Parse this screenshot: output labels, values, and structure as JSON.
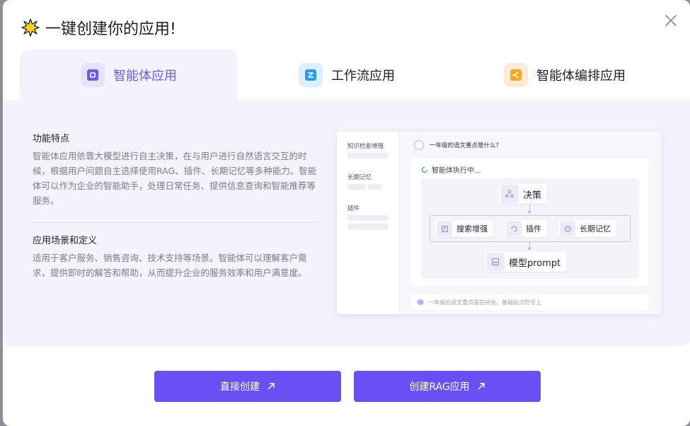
{
  "dialog": {
    "title": "一键创建你的应用!"
  },
  "tabs": [
    {
      "label": "智能体应用",
      "active": true,
      "icon": "agent-icon",
      "color": "#6c5ce7"
    },
    {
      "label": "工作流应用",
      "active": false,
      "icon": "workflow-icon",
      "color": "#2d8cf0"
    },
    {
      "label": "智能体编排应用",
      "active": false,
      "icon": "orchestration-icon",
      "color": "#f5a623"
    }
  ],
  "features": {
    "heading": "功能特点",
    "text": "智能体应用依靠大模型进行自主决策，在与用户进行自然语言交互的时候，根据用户问题自主选择使用RAG、插件、长期记忆等多种能力。智能体可以作为企业的智能助手，处理日常任务、提供信息查询和智能推荐等服务。"
  },
  "scenarios": {
    "heading": "应用场景和定义",
    "text": "适用于客户服务、销售咨询、技术支持等场景。智能体可以理解客户需求，提供即时的解答和帮助，从而提升企业的服务效率和用户满意度。"
  },
  "preview": {
    "sidebar": [
      "知识检索增强",
      "长期记忆",
      "插件"
    ],
    "question": "一年级的语文重点是什么?",
    "running": "智能体执行中...",
    "nodes": {
      "decision": "决策",
      "search": "搜索增强",
      "plugin": "插件",
      "memory": "长期记忆",
      "model": "模型prompt"
    },
    "answer": "一年级的语文重点是在拼音、基础标点符号上"
  },
  "buttons": {
    "direct": "直接创建",
    "rag": "创建RAG应用"
  },
  "colors": {
    "accent": "#6850f5",
    "panel_bg": "#f3f3fd"
  }
}
